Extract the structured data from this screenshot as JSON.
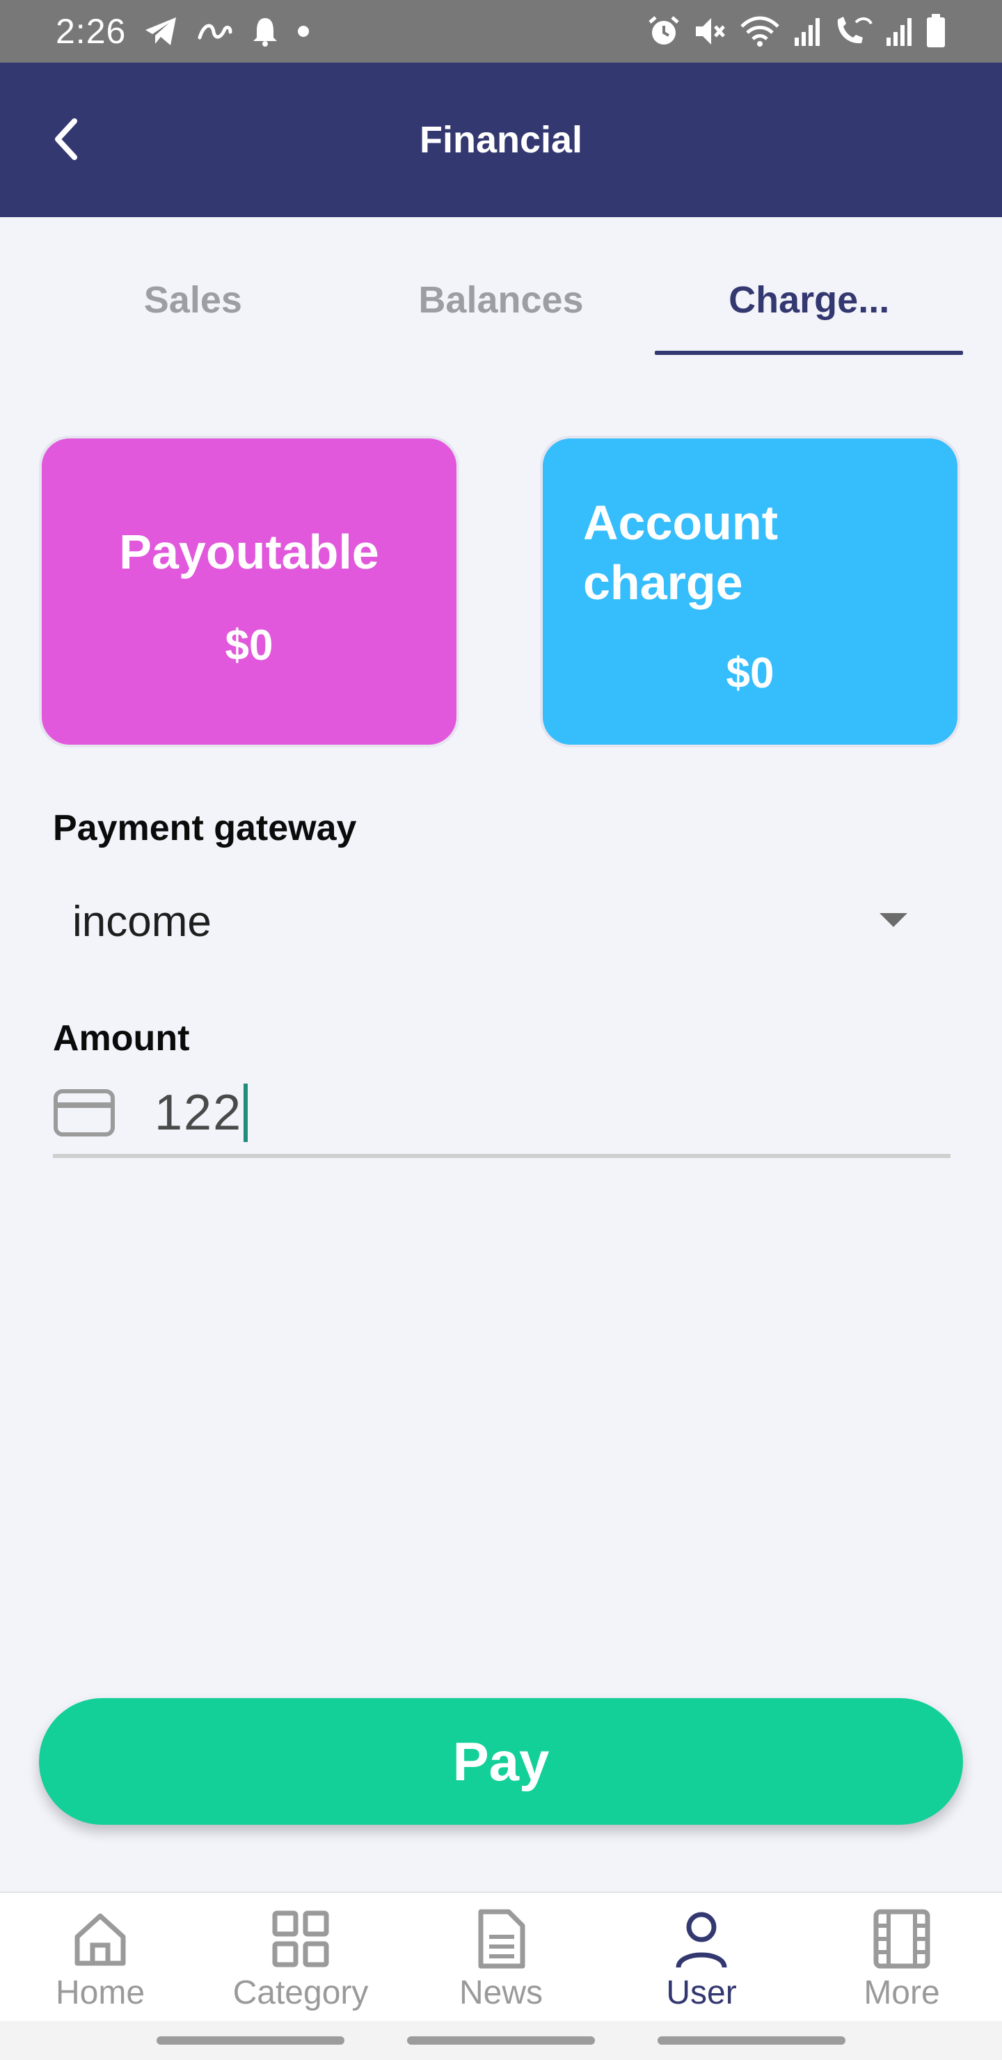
{
  "status_bar": {
    "time": "2:26",
    "left_icons": [
      "telegram-icon",
      "aliexpress-icon",
      "notification-bell-icon",
      "dot-icon"
    ],
    "right_icons": [
      "alarm-icon",
      "mute-icon",
      "wifi-icon",
      "signal-icon",
      "wifi-calling-icon",
      "signal-2-icon",
      "battery-icon"
    ]
  },
  "header": {
    "title": "Financial",
    "back_icon": "chevron-left-icon"
  },
  "tabs": [
    {
      "label": "Sales",
      "active": false
    },
    {
      "label": "Balances",
      "active": false
    },
    {
      "label": "Charge...",
      "active": true
    }
  ],
  "cards": {
    "payoutable": {
      "title": "Payoutable",
      "value": "$0",
      "color": "#e158dc"
    },
    "account_charge": {
      "title": "Account charge",
      "value": "$0",
      "color": "#35bdfc"
    }
  },
  "form": {
    "gateway_label": "Payment gateway",
    "gateway_value": "income",
    "amount_label": "Amount",
    "amount_value": "122",
    "amount_icon": "credit-card-icon"
  },
  "pay_button": {
    "label": "Pay",
    "color": "#13cf98"
  },
  "bottom_nav": [
    {
      "label": "Home",
      "icon": "home-icon",
      "active": false
    },
    {
      "label": "Category",
      "icon": "grid-icon",
      "active": false
    },
    {
      "label": "News",
      "icon": "document-icon",
      "active": false
    },
    {
      "label": "User",
      "icon": "user-icon",
      "active": true
    },
    {
      "label": "More",
      "icon": "film-icon",
      "active": false
    }
  ],
  "colors": {
    "header": "#343870",
    "background": "#f3f4fa",
    "active_tab": "#343870",
    "inactive": "#9d9da4"
  }
}
